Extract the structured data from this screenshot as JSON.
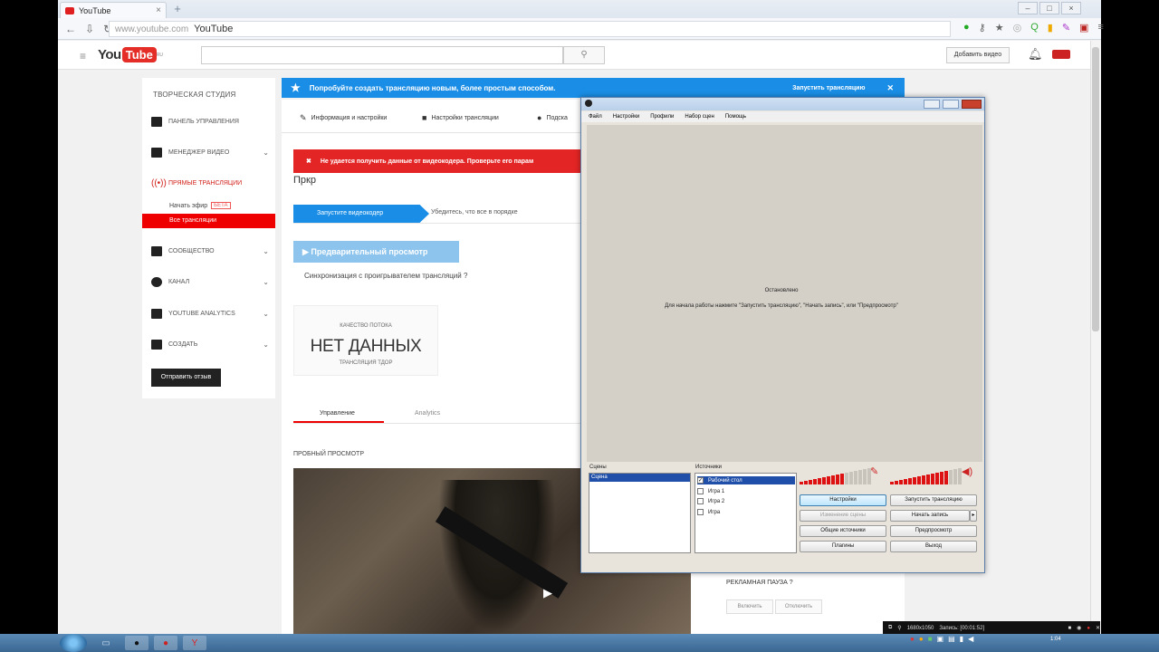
{
  "browser": {
    "tab_title": "YouTube",
    "url_domain": "www.youtube.com",
    "url_title": "YouTube"
  },
  "youtube": {
    "logo_you": "You",
    "logo_tube": "Tube",
    "logo_region": "RU",
    "add_video": "Добавить видео"
  },
  "sidebar": {
    "studio_title": "ТВОРЧЕСКАЯ СТУДИЯ",
    "items": [
      {
        "label": "ПАНЕЛЬ УПРАВЛЕНИЯ"
      },
      {
        "label": "МЕНЕДЖЕР ВИДЕО"
      },
      {
        "label": "ПРЯМЫЕ ТРАНСЛЯЦИИ"
      },
      {
        "label": "СООБЩЕСТВО"
      },
      {
        "label": "КАНАЛ"
      },
      {
        "label": "YOUTUBE ANALYTICS"
      },
      {
        "label": "СОЗДАТЬ"
      }
    ],
    "sub_start": "Начать эфир",
    "sub_badge": "БЕТА",
    "sub_all": "Все трансляции",
    "feedback": "Отправить отзыв"
  },
  "banner": {
    "text": "Попробуйте создать трансляцию новым, более простым способом.",
    "launch": "Запустить трансляцию"
  },
  "main": {
    "tabs": [
      "Информация и настройки",
      "Настройки трансляции",
      "Подска"
    ],
    "error": "Не удается получить данные от видеокодера. Проверьте его парам",
    "title": "Пркр",
    "step1": "Запустите видеокодер",
    "step2": "Убедитесь, что все в порядке",
    "preview_button": "Предварительный просмотр",
    "sync": "Синхронизация с проигрывателем трансляций",
    "quality_label": "КАЧЕСТВО ПОТОКА",
    "quality_value": "НЕТ ДАННЫХ",
    "quality_sub": "ТРАНСЛЯЦИЯ ТДОР",
    "subtab_manage": "Управление",
    "subtab_analytics": "Analytics",
    "preview_label": "ПРОБНЫЙ ПРОСМОТР",
    "ad_break": "РЕКЛАМНАЯ ПАУЗА",
    "ad_btn1": "Включить",
    "ad_btn2": "Отключить"
  },
  "obs": {
    "menu": [
      "Файл",
      "Настройки",
      "Профили",
      "Набор сцен",
      "Помощь"
    ],
    "msg1": "Остановлено",
    "msg2": "Для начала работы нажмите \"Запустить трансляцию\", \"Начать запись\", или \"Предпросмотр\"",
    "scenes_label": "Сцены",
    "sources_label": "Источники",
    "scene_selected": "Сцена",
    "sources": [
      {
        "label": "Рабочий стол",
        "checked": true
      },
      {
        "label": "Игра 1",
        "checked": false
      },
      {
        "label": "Игра 2",
        "checked": false
      },
      {
        "label": "Игра",
        "checked": false
      }
    ],
    "mic_level": 0.6,
    "desktop_level": 0.8,
    "buttons": {
      "settings": "Настройки",
      "start_stream": "Запустить трансляцию",
      "edit_scene": "Изменение сцены",
      "start_record": "Начать запись",
      "global_sources": "Общие источники",
      "preview": "Предпросмотр",
      "plugins": "Плагины",
      "exit": "Выход"
    }
  },
  "recpanel": {
    "resolution": "1680x1050",
    "record": "Запись: [00:01:52]"
  },
  "taskbar": {
    "clock": "1:04"
  }
}
